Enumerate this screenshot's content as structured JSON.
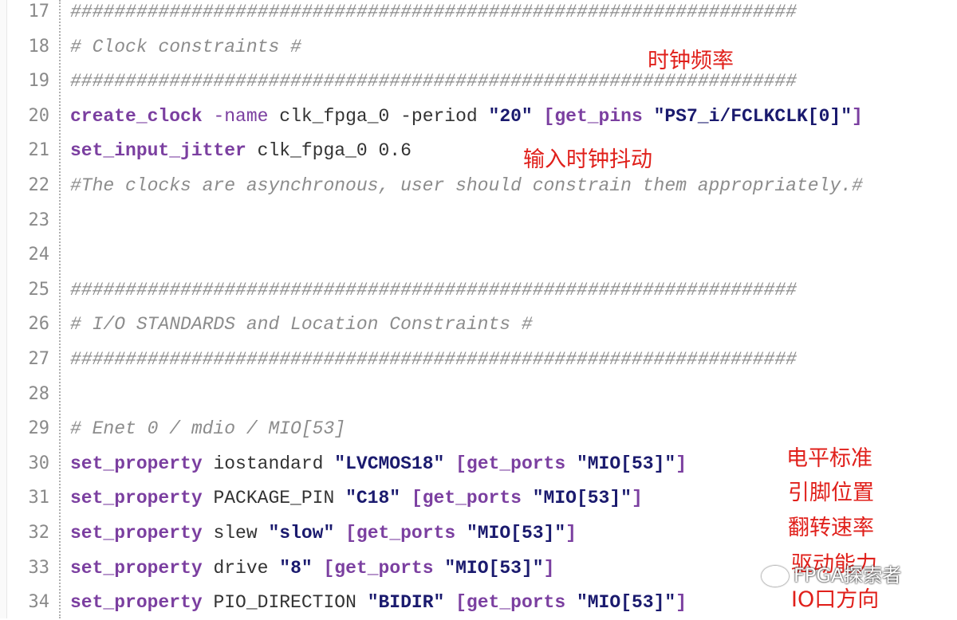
{
  "lines": [
    {
      "num": "17",
      "parts": [
        {
          "cls": "comment",
          "text": "##################################################################"
        }
      ]
    },
    {
      "num": "18",
      "parts": [
        {
          "cls": "comment",
          "text": "# Clock constraints                                                 #"
        }
      ]
    },
    {
      "num": "19",
      "parts": [
        {
          "cls": "comment",
          "text": "##################################################################"
        }
      ]
    },
    {
      "num": "20",
      "parts": [
        {
          "cls": "kw",
          "text": "create_clock"
        },
        {
          "cls": "opt",
          "text": " -name"
        },
        {
          "cls": "plain",
          "text": " clk_fpga_0 -period "
        },
        {
          "cls": "str",
          "text": "\"20\""
        },
        {
          "cls": "plain",
          "text": " "
        },
        {
          "cls": "brk",
          "text": "[get_pins "
        },
        {
          "cls": "str",
          "text": "\"PS7_i/FCLKCLK[0]\""
        },
        {
          "cls": "brk",
          "text": "]"
        }
      ]
    },
    {
      "num": "21",
      "parts": [
        {
          "cls": "kw",
          "text": "set_input_jitter"
        },
        {
          "cls": "plain",
          "text": " clk_fpga_0 0.6"
        }
      ]
    },
    {
      "num": "22",
      "parts": [
        {
          "cls": "comment",
          "text": "#The clocks are asynchronous, user should constrain them appropriately.#"
        }
      ]
    },
    {
      "num": "23",
      "parts": []
    },
    {
      "num": "24",
      "parts": []
    },
    {
      "num": "25",
      "parts": [
        {
          "cls": "comment",
          "text": "##################################################################"
        }
      ]
    },
    {
      "num": "26",
      "parts": [
        {
          "cls": "comment",
          "text": "# I/O STANDARDS and Location Constraints                            #"
        }
      ]
    },
    {
      "num": "27",
      "parts": [
        {
          "cls": "comment",
          "text": "##################################################################"
        }
      ]
    },
    {
      "num": "28",
      "parts": []
    },
    {
      "num": "29",
      "parts": [
        {
          "cls": "comment",
          "text": "#  Enet 0 / mdio / MIO[53]"
        }
      ]
    },
    {
      "num": "30",
      "parts": [
        {
          "cls": "kw",
          "text": "set_property"
        },
        {
          "cls": "plain",
          "text": " iostandard "
        },
        {
          "cls": "str",
          "text": "\"LVCMOS18\""
        },
        {
          "cls": "plain",
          "text": " "
        },
        {
          "cls": "brk",
          "text": "[get_ports "
        },
        {
          "cls": "str",
          "text": "\"MIO[53]\""
        },
        {
          "cls": "brk",
          "text": "]"
        }
      ]
    },
    {
      "num": "31",
      "parts": [
        {
          "cls": "kw",
          "text": "set_property"
        },
        {
          "cls": "plain",
          "text": " PACKAGE_PIN "
        },
        {
          "cls": "str",
          "text": "\"C18\""
        },
        {
          "cls": "plain",
          "text": " "
        },
        {
          "cls": "brk",
          "text": "[get_ports "
        },
        {
          "cls": "str",
          "text": "\"MIO[53]\""
        },
        {
          "cls": "brk",
          "text": "]"
        }
      ]
    },
    {
      "num": "32",
      "parts": [
        {
          "cls": "kw",
          "text": "set_property"
        },
        {
          "cls": "plain",
          "text": " slew "
        },
        {
          "cls": "str",
          "text": "\"slow\""
        },
        {
          "cls": "plain",
          "text": " "
        },
        {
          "cls": "brk",
          "text": "[get_ports "
        },
        {
          "cls": "str",
          "text": "\"MIO[53]\""
        },
        {
          "cls": "brk",
          "text": "]"
        }
      ]
    },
    {
      "num": "33",
      "parts": [
        {
          "cls": "kw",
          "text": "set_property"
        },
        {
          "cls": "plain",
          "text": " drive "
        },
        {
          "cls": "str",
          "text": "\"8\""
        },
        {
          "cls": "plain",
          "text": " "
        },
        {
          "cls": "brk",
          "text": "[get_ports "
        },
        {
          "cls": "str",
          "text": "\"MIO[53]\""
        },
        {
          "cls": "brk",
          "text": "]"
        }
      ]
    },
    {
      "num": "34",
      "parts": [
        {
          "cls": "kw",
          "text": "set_property"
        },
        {
          "cls": "plain",
          "text": " PIO_DIRECTION "
        },
        {
          "cls": "str",
          "text": "\"BIDIR\""
        },
        {
          "cls": "plain",
          "text": " "
        },
        {
          "cls": "brk",
          "text": "[get_ports "
        },
        {
          "cls": "str",
          "text": "\"MIO[53]\""
        },
        {
          "cls": "brk",
          "text": "]"
        }
      ]
    }
  ],
  "annotations": {
    "clock_freq": "时钟频率",
    "input_jitter": "输入时钟抖动",
    "iostandard": "电平标准",
    "package_pin": "引脚位置",
    "slew": "翻转速率",
    "drive": "驱动能力",
    "direction": "IO口方向"
  },
  "watermark": "FPGA探索者",
  "colors": {
    "keyword": "#7b3fa0",
    "string": "#1a1a6e",
    "comment": "#8c8c8c",
    "annotation": "#e0201b"
  }
}
